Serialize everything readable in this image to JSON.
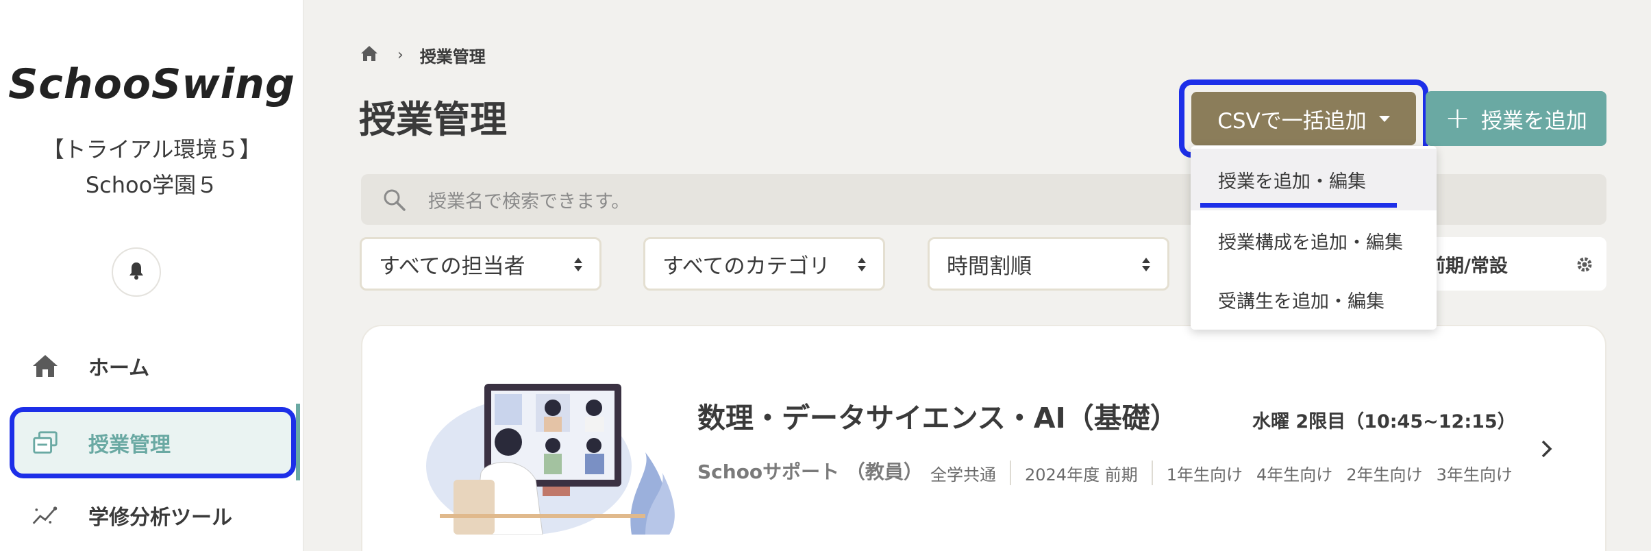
{
  "sidebar": {
    "logo": "SchooSwing",
    "org_name": "【トライアル環境５】Schoo学園５",
    "nav": {
      "home": "ホーム",
      "classes": "授業管理",
      "analytics": "学修分析ツール"
    }
  },
  "breadcrumb": {
    "separator": "›",
    "current": "授業管理"
  },
  "page_title": "授業管理",
  "actions": {
    "csv_label": "CSVで一括追加",
    "add_label": "授業を追加",
    "add_symbol": "+"
  },
  "csv_menu": {
    "items": [
      "授業を追加・編集",
      "授業構成を追加・編集",
      "受講生を追加・編集"
    ]
  },
  "search": {
    "placeholder": "授業名で検索できます。"
  },
  "filters": {
    "owner": "すべての担当者",
    "category": "すべてのカテゴリ",
    "sort": "時間割順",
    "term": "前期/常設"
  },
  "course": {
    "title": "数理・データサイエンス・AI（基礎）",
    "time": "水曜 2限目（10:45~12:15）",
    "owner": "Schooサポート （教員）",
    "dept": "全学共通",
    "term": "2024年度 前期",
    "grades": [
      "1年生向け",
      "4年生向け",
      "2年生向け",
      "3年生向け"
    ]
  },
  "colors": {
    "accent_teal": "#6aa9a3",
    "csv_brown": "#8b7d5a",
    "highlight_blue": "#1d2fe8",
    "background": "#f2f1ee"
  }
}
